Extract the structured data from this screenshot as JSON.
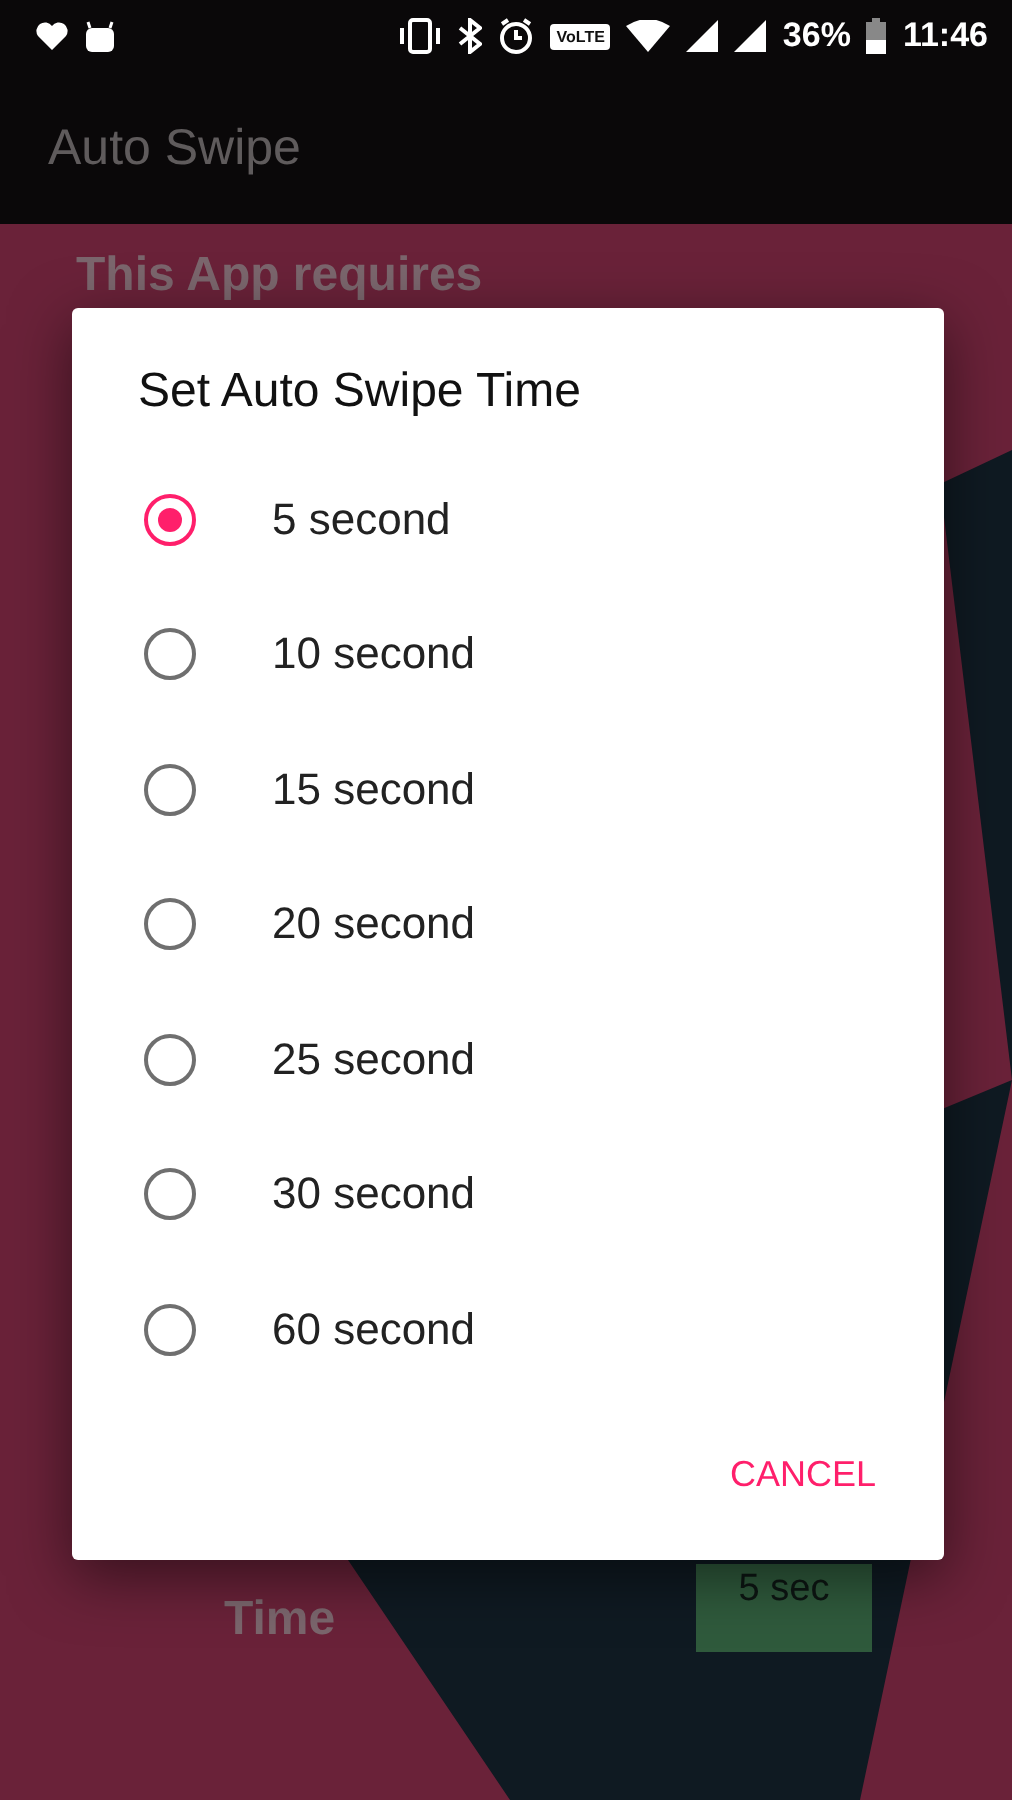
{
  "status_bar": {
    "network": "VoLTE",
    "battery": "36%",
    "time": "11:46"
  },
  "app_bar": {
    "title": "Auto Swipe"
  },
  "background": {
    "notice": "This App requires",
    "setting_label": "Time",
    "setting_value": "5 sec"
  },
  "dialog": {
    "title": "Set Auto Swipe Time",
    "options": [
      {
        "label": "5 second",
        "selected": true
      },
      {
        "label": "10 second",
        "selected": false
      },
      {
        "label": "15 second",
        "selected": false
      },
      {
        "label": "20 second",
        "selected": false
      },
      {
        "label": "25 second",
        "selected": false
      },
      {
        "label": "30 second",
        "selected": false
      },
      {
        "label": "60 second",
        "selected": false
      }
    ],
    "buttons": [
      "CANCEL"
    ]
  }
}
